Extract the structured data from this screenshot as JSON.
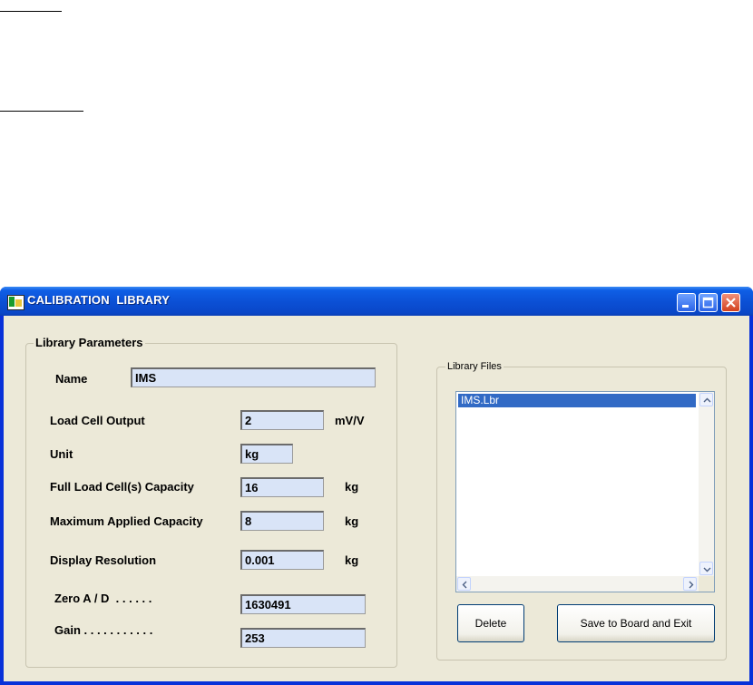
{
  "window": {
    "title": "CALIBRATION  LIBRARY"
  },
  "library_parameters": {
    "group_label": "Library Parameters",
    "name_label": "Name",
    "name_value": "IMS",
    "load_cell_output_label": "Load Cell Output",
    "load_cell_output_value": "2",
    "load_cell_output_unit": "mV/V",
    "unit_label": "Unit",
    "unit_value": "kg",
    "full_capacity_label": "Full Load Cell(s) Capacity",
    "full_capacity_value": "16",
    "full_capacity_unit": "kg",
    "max_applied_label": "Maximum Applied Capacity",
    "max_applied_value": "8",
    "max_applied_unit": "kg",
    "display_resolution_label": "Display Resolution",
    "display_resolution_value": "0.001",
    "display_resolution_unit": "kg",
    "zero_ad_label": "Zero A / D  . . . . . .",
    "zero_ad_value": "1630491",
    "gain_label": "Gain . . . . . . . . . . .",
    "gain_value": "253"
  },
  "library_files": {
    "group_label": "Library Files",
    "items": [
      "IMS.Lbr"
    ],
    "delete_label": "Delete",
    "save_exit_label": "Save to Board and Exit"
  },
  "colors": {
    "titlebar": "#0b4fd4",
    "face": "#ece9d8",
    "field_bg": "#d9e4f7",
    "selection": "#316ac5"
  }
}
